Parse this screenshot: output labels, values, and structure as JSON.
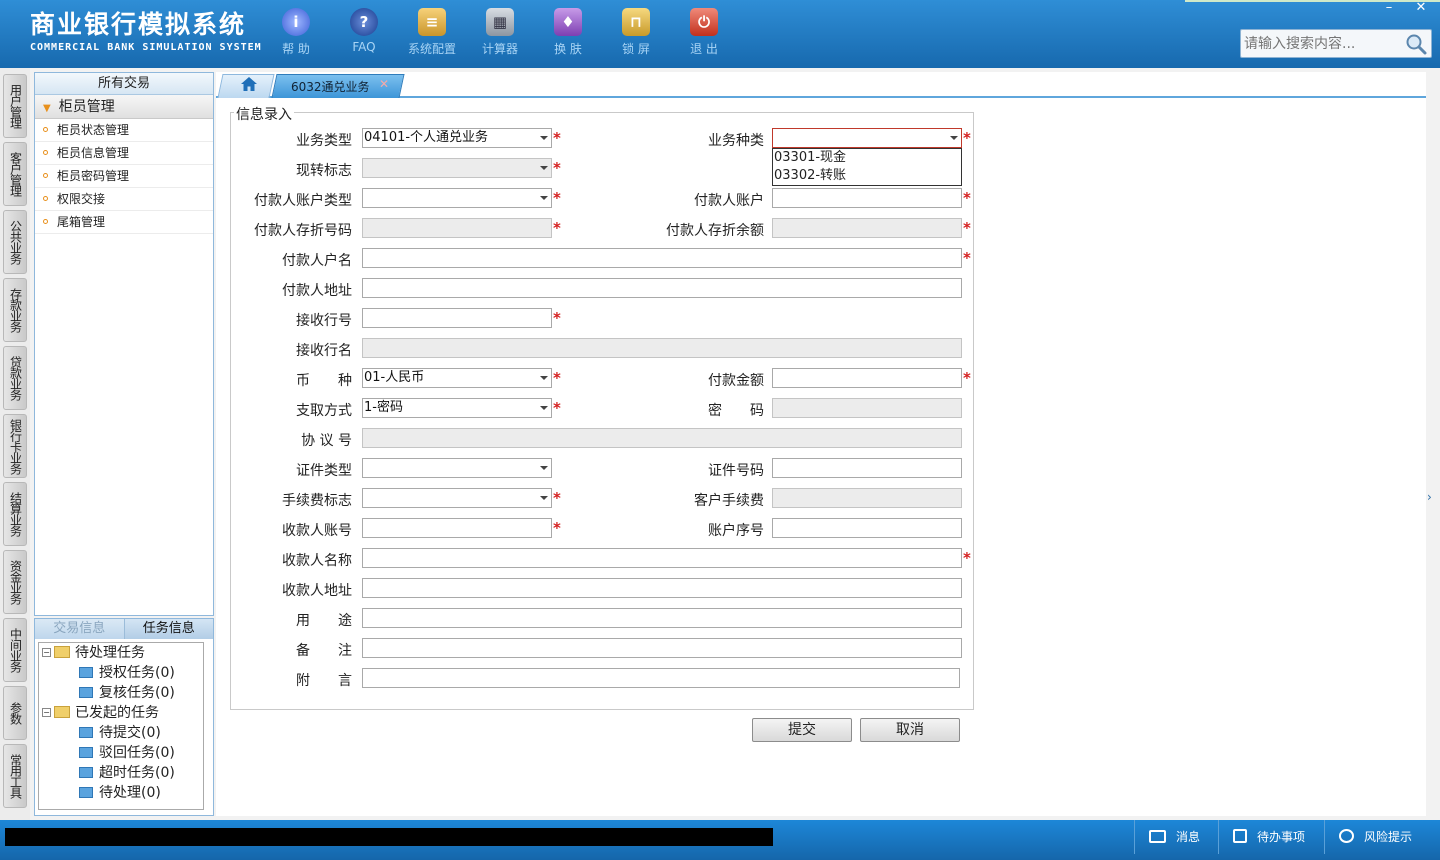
{
  "header": {
    "title_cn": "商业银行模拟系统",
    "title_en": "COMMERCIAL BANK SIMULATION SYSTEM",
    "toolbar": [
      {
        "label": "帮 助",
        "icon": "help-icon"
      },
      {
        "label": "FAQ",
        "icon": "faq-icon"
      },
      {
        "label": "系统配置",
        "icon": "settings-icon"
      },
      {
        "label": "计算器",
        "icon": "calculator-icon"
      },
      {
        "label": "换 肤",
        "icon": "skin-icon"
      },
      {
        "label": "锁 屏",
        "icon": "lock-icon"
      },
      {
        "label": "退 出",
        "icon": "exit-icon"
      }
    ],
    "window_minimize": "–",
    "window_close": "✕",
    "search_placeholder": "请输入搜索内容..."
  },
  "module_tabs": [
    "用户管理",
    "客户管理",
    "公共业务",
    "存款业务",
    "贷款业务",
    "银行卡业务",
    "结算业务",
    "资金业务",
    "中间业务",
    "参数",
    "常用工具"
  ],
  "left_panel": {
    "header": "所有交易",
    "group": "柜员管理",
    "items": [
      "柜员状态管理",
      "柜员信息管理",
      "柜员密码管理",
      "权限交接",
      "尾箱管理"
    ]
  },
  "task_panel": {
    "tab_inactive": "交易信息",
    "tab_active": "任务信息",
    "tree": {
      "pending": "待处理任务",
      "auth": "授权任务(0)",
      "review": "复核任务(0)",
      "initiated": "已发起的任务",
      "to_submit": "待提交(0)",
      "rejected": "驳回任务(0)",
      "timeout": "超时任务(0)",
      "to_process": "待处理(0)"
    }
  },
  "content": {
    "active_tab": "6032通兑业务",
    "close_glyph": "✕",
    "section_title": "信息录入",
    "required_mark": "*",
    "fields": {
      "business_type": {
        "label": "业务类型",
        "value": "04101-个人通兑业务"
      },
      "business_kind": {
        "label": "业务种类",
        "value": ""
      },
      "cash_transfer_flag": {
        "label": "现转标志",
        "value": ""
      },
      "payer_account_type": {
        "label": "付款人账户类型",
        "value": ""
      },
      "payer_account": {
        "label": "付款人账户",
        "value": ""
      },
      "payer_passbook_no": {
        "label": "付款人存折号码",
        "value": ""
      },
      "payer_passbook_balance": {
        "label": "付款人存折余额",
        "value": ""
      },
      "payer_name": {
        "label": "付款人户名",
        "value": ""
      },
      "payer_address": {
        "label": "付款人地址",
        "value": ""
      },
      "receiving_bank_no": {
        "label": "接收行号",
        "value": ""
      },
      "receiving_bank_name": {
        "label": "接收行名",
        "value": ""
      },
      "currency": {
        "label": "币　　种",
        "value": "01-人民币"
      },
      "payment_amount": {
        "label": "付款金额",
        "value": ""
      },
      "withdraw_method": {
        "label": "支取方式",
        "value": "1-密码"
      },
      "password": {
        "label": "密　　码",
        "value": ""
      },
      "agreement_no": {
        "label": "协 议 号",
        "value": ""
      },
      "id_type": {
        "label": "证件类型",
        "value": ""
      },
      "id_number": {
        "label": "证件号码",
        "value": ""
      },
      "fee_flag": {
        "label": "手续费标志",
        "value": ""
      },
      "customer_fee": {
        "label": "客户手续费",
        "value": ""
      },
      "payee_account": {
        "label": "收款人账号",
        "value": ""
      },
      "account_seq": {
        "label": "账户序号",
        "value": ""
      },
      "payee_name": {
        "label": "收款人名称",
        "value": ""
      },
      "payee_address": {
        "label": "收款人地址",
        "value": ""
      },
      "purpose": {
        "label": "用　　途",
        "value": ""
      },
      "remark": {
        "label": "备　　注",
        "value": ""
      },
      "postscript": {
        "label": "附　　言",
        "value": ""
      }
    },
    "dropdown_options": [
      "03301-现金",
      "03302-转账"
    ],
    "submit": "提交",
    "cancel": "取消"
  },
  "statusbar": {
    "messages": "消息",
    "todo": "待办事项",
    "risk": "风险提示"
  },
  "colors": {
    "header_blue": "#1769ae",
    "required_red": "#d42020",
    "accent_orange": "#e8901c"
  }
}
